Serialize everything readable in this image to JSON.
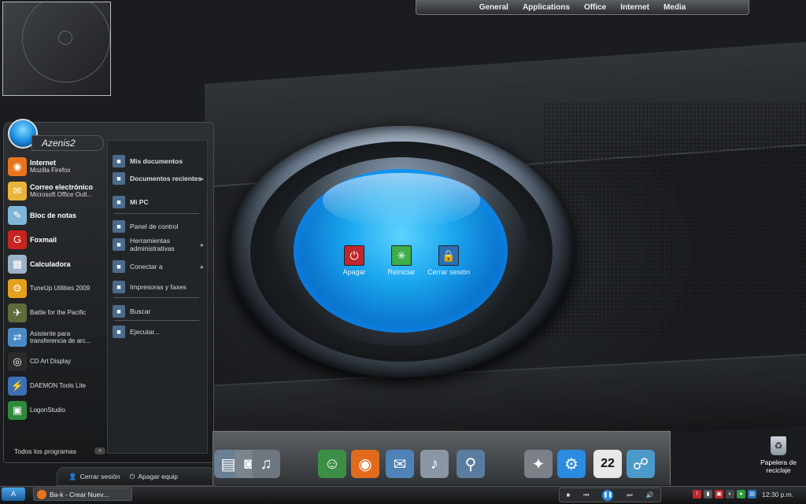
{
  "top_menu": [
    "General",
    "Applications",
    "Office",
    "Internet",
    "Media"
  ],
  "start_menu": {
    "username": "Azenis2",
    "pinned": [
      {
        "title": "Internet",
        "subtitle": "Mozilla Firefox",
        "icon": "firefox-icon",
        "color": "#e8741d",
        "glyph": "◉"
      },
      {
        "title": "Correo electrónico",
        "subtitle": "Microsoft Office Outl...",
        "icon": "mail-icon",
        "color": "#e9b43a",
        "glyph": "✉"
      }
    ],
    "recent": [
      {
        "label": "Bloc de notas",
        "bold": true,
        "icon": "notepad-icon",
        "color": "#7fb4d8",
        "glyph": "✎"
      },
      {
        "label": "Foxmail",
        "bold": true,
        "icon": "foxmail-icon",
        "color": "#c8231f",
        "glyph": "G"
      },
      {
        "label": "Calculadora",
        "bold": true,
        "icon": "calculator-icon",
        "color": "#9db2c7",
        "glyph": "▦"
      },
      {
        "label": "TuneUp Utilities 2009",
        "bold": false,
        "icon": "tuneup-icon",
        "color": "#e4a11b",
        "glyph": "⚙"
      },
      {
        "label": "Battle for the Pacific",
        "bold": false,
        "icon": "battle-icon",
        "color": "#5f6b3b",
        "glyph": "✈"
      },
      {
        "label": "Asistente para transferencia de arc...",
        "bold": false,
        "icon": "transfer-icon",
        "color": "#4a8bc6",
        "glyph": "⇄"
      },
      {
        "label": "CD Art Display",
        "bold": false,
        "icon": "cd-icon",
        "color": "#2b2b2b",
        "glyph": "◎"
      },
      {
        "label": "DAEMON Tools Lite",
        "bold": false,
        "icon": "daemon-icon",
        "color": "#3c6fb3",
        "glyph": "⚡"
      },
      {
        "label": "LogonStudio",
        "bold": false,
        "icon": "logonstudio-icon",
        "color": "#2f8a3a",
        "glyph": "▣"
      }
    ],
    "all_programs": "Todos los programas",
    "right": [
      {
        "label": "Mis documentos",
        "bold": true,
        "icon": "documents-icon",
        "arrow": false
      },
      {
        "label": "Documentos recientes",
        "bold": true,
        "icon": "recent-docs-icon",
        "arrow": true
      },
      {
        "label": "Mi PC",
        "bold": true,
        "icon": "computer-icon",
        "arrow": false
      },
      {
        "label": "Panel de control",
        "bold": false,
        "icon": "control-panel-icon",
        "arrow": false
      },
      {
        "label": "Herramientas administrativas",
        "bold": false,
        "icon": "admin-tools-icon",
        "arrow": true
      },
      {
        "label": "Conectar a",
        "bold": false,
        "icon": "connect-icon",
        "arrow": true
      },
      {
        "label": "Impresoras y faxes",
        "bold": false,
        "icon": "printer-icon",
        "arrow": false
      },
      {
        "label": "Buscar",
        "bold": false,
        "icon": "search-icon",
        "arrow": false
      },
      {
        "label": "Ejecutar...",
        "bold": false,
        "icon": "run-icon",
        "arrow": false
      }
    ],
    "logoff": "Cerrar sesión",
    "shutdown": "Apagar equip"
  },
  "power_widget": [
    {
      "label": "Apagar",
      "icon": "power-off-icon",
      "color": "#c0262d",
      "glyph": "⏻"
    },
    {
      "label": "Reiniciar",
      "icon": "restart-icon",
      "color": "#3fae49",
      "glyph": "✳"
    },
    {
      "label": "Cerrar sesión",
      "icon": "lock-icon",
      "color": "#2a6fb6",
      "glyph": "🔒"
    }
  ],
  "dock": [
    {
      "icon": "folder-icon",
      "color": "#6b7f93",
      "glyph": "▤"
    },
    {
      "icon": "camera-icon",
      "color": "#7d858c",
      "glyph": "◙"
    },
    {
      "icon": "music-icon",
      "color": "#6e7780",
      "glyph": "♫"
    },
    {
      "icon": "messenger-icon",
      "color": "#3b8f44",
      "glyph": "☺"
    },
    {
      "icon": "firefox-icon",
      "color": "#e06b1c",
      "glyph": "◉"
    },
    {
      "icon": "mail-icon",
      "color": "#4f83b8",
      "glyph": "✉"
    },
    {
      "icon": "itunes-icon",
      "color": "#8a96a3",
      "glyph": "♪"
    },
    {
      "icon": "search-icon",
      "color": "#5a7ca0",
      "glyph": "⚲"
    },
    {
      "icon": "system-icon",
      "color": "#7c8087",
      "glyph": "✦"
    },
    {
      "icon": "settings-icon",
      "color": "#2a8be0",
      "glyph": "⚙"
    },
    {
      "icon": "calendar-icon",
      "color": "#e8e8e8",
      "glyph": "22"
    },
    {
      "icon": "network-icon",
      "color": "#4b9ac9",
      "glyph": "☍"
    }
  ],
  "recycle_bin": "Papelera de reciclaje",
  "taskbar": {
    "start": "A",
    "task": "Ba-k - Crear Nuev...",
    "clock": "12:30 p.m."
  }
}
